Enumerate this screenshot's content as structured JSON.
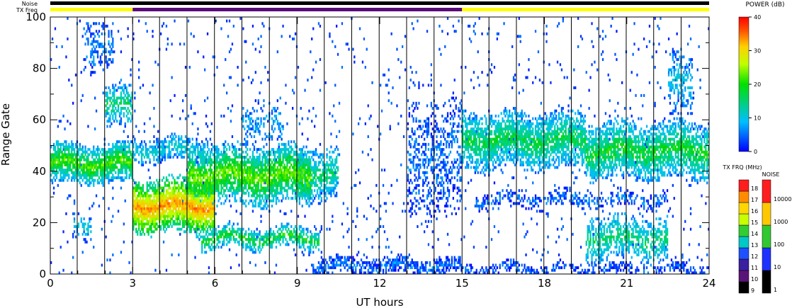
{
  "chart_data": {
    "type": "heatmap",
    "title": "",
    "xlabel": "UT hours",
    "ylabel": "Range Gate",
    "xlim": [
      0,
      24
    ],
    "ylim": [
      0,
      100
    ],
    "x_ticks": [
      "0",
      "3",
      "6",
      "9",
      "12",
      "15",
      "18",
      "21",
      "24"
    ],
    "y_ticks": [
      "0",
      "20",
      "40",
      "60",
      "80",
      "100"
    ],
    "scan_boundaries_ut": [
      0.98,
      1.98,
      3.0,
      3.98,
      4.98,
      5.98,
      6.98,
      7.98,
      8.98,
      9.98,
      10.98,
      11.98,
      12.98,
      13.98,
      15.0,
      15.98,
      16.98,
      17.98,
      18.98,
      19.98,
      20.98,
      21.98,
      22.98
    ],
    "status_bars": {
      "noise_label": "Noise",
      "txfreq_label": "TX Freq",
      "noise_color": "#000000",
      "txfreq_segments": [
        {
          "start": 0,
          "end": 3,
          "color": "#ffff00"
        },
        {
          "start": 3,
          "end": 15,
          "color": "#5a0a78"
        },
        {
          "start": 15,
          "end": 24,
          "color": "#ffff00"
        }
      ]
    },
    "power_scale": {
      "title": "POWER (dB)",
      "ticks": [
        "0",
        "10",
        "20",
        "30",
        "40"
      ],
      "range": [
        0,
        40
      ]
    },
    "txfreq_scale": {
      "title": "TX FRQ (MHz)",
      "ticks": [
        "9",
        "10",
        "11",
        "12",
        "13",
        "14",
        "15",
        "16",
        "17",
        "18"
      ],
      "colors": [
        "#000000",
        "#5a1478",
        "#3c1ea0",
        "#1e50ff",
        "#00c8c8",
        "#32cd32",
        "#c8ff00",
        "#ffd700",
        "#ff8c00",
        "#ff1e1e"
      ]
    },
    "noise_scale": {
      "title": "NOISE",
      "ticks": [
        "1",
        "10",
        "100",
        "1000",
        "10000"
      ],
      "colors": [
        "#000000",
        "#1e32ff",
        "#32c832",
        "#ffc800",
        "#ff1e1e"
      ]
    },
    "echo_regions": [
      {
        "t0": 0.0,
        "t1": 3.0,
        "g0": 36,
        "g1": 50,
        "power": 16,
        "density": 0.85
      },
      {
        "t0": 0.8,
        "t1": 1.5,
        "g0": 14,
        "g1": 24,
        "power": 8,
        "density": 0.45
      },
      {
        "t0": 1.2,
        "t1": 2.3,
        "g0": 80,
        "g1": 100,
        "power": 5,
        "density": 0.3
      },
      {
        "t0": 2.0,
        "t1": 3.0,
        "g0": 58,
        "g1": 73,
        "power": 12,
        "density": 0.55
      },
      {
        "t0": 3.0,
        "t1": 6.0,
        "g0": 17,
        "g1": 36,
        "power": 26,
        "density": 0.95
      },
      {
        "t0": 3.0,
        "t1": 5.8,
        "g0": 44,
        "g1": 53,
        "power": 9,
        "density": 0.6
      },
      {
        "t0": 5.0,
        "t1": 9.5,
        "g0": 28,
        "g1": 49,
        "power": 17,
        "density": 0.85
      },
      {
        "t0": 9.0,
        "t1": 10.5,
        "g0": 30,
        "g1": 48,
        "power": 12,
        "density": 0.65
      },
      {
        "t0": 5.5,
        "t1": 9.8,
        "g0": 10,
        "g1": 18,
        "power": 14,
        "density": 0.7
      },
      {
        "t0": 7.0,
        "t1": 8.5,
        "g0": 50,
        "g1": 68,
        "power": 6,
        "density": 0.25
      },
      {
        "t0": 9.5,
        "t1": 15.0,
        "g0": 0,
        "g1": 6,
        "power": 4,
        "density": 0.6
      },
      {
        "t0": 13.0,
        "t1": 15.0,
        "g0": 25,
        "g1": 65,
        "power": 4,
        "density": 0.35
      },
      {
        "t0": 15.0,
        "t1": 19.5,
        "g0": 42,
        "g1": 62,
        "power": 13,
        "density": 0.8
      },
      {
        "t0": 19.5,
        "t1": 24.0,
        "g0": 38,
        "g1": 58,
        "power": 14,
        "density": 0.8
      },
      {
        "t0": 15.5,
        "t1": 22.5,
        "g0": 26,
        "g1": 32,
        "power": 4,
        "density": 0.4
      },
      {
        "t0": 19.5,
        "t1": 22.5,
        "g0": 6,
        "g1": 22,
        "power": 12,
        "density": 0.55
      },
      {
        "t0": 22.5,
        "t1": 23.4,
        "g0": 62,
        "g1": 85,
        "power": 8,
        "density": 0.4
      },
      {
        "t0": 15.0,
        "t1": 24.0,
        "g0": 0,
        "g1": 4,
        "power": 3,
        "density": 0.45
      }
    ],
    "sparse_fraction": 0.025
  }
}
